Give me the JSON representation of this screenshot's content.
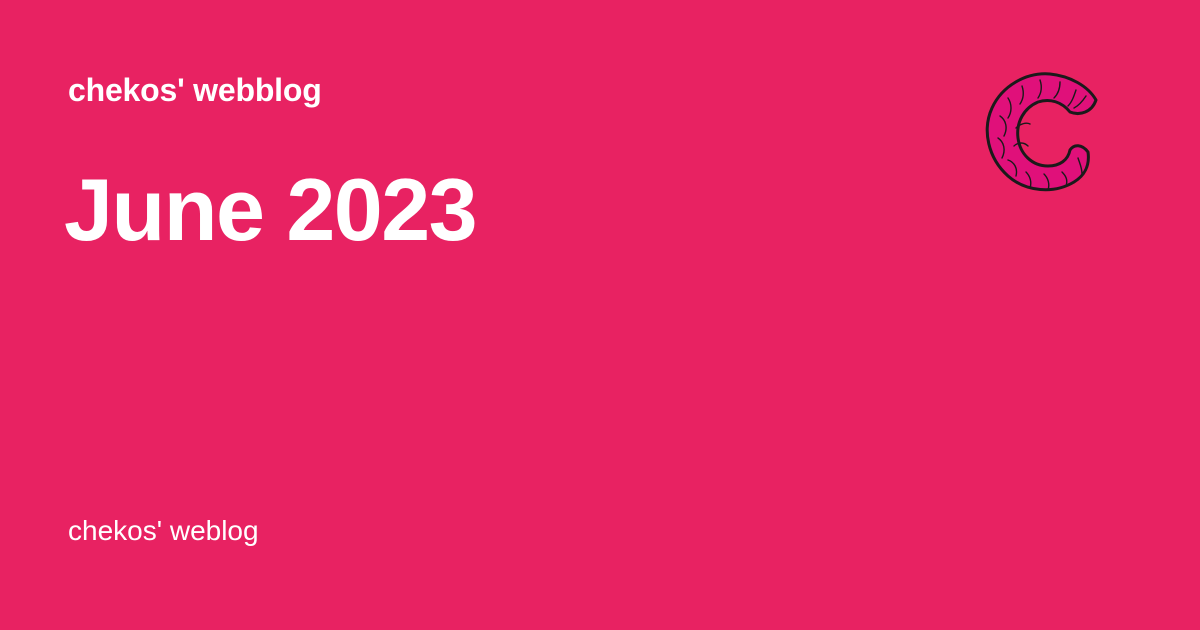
{
  "header": {
    "site_name": "chekos' webblog"
  },
  "main": {
    "title": "June 2023"
  },
  "footer": {
    "site_name": "chekos' weblog"
  },
  "logo": {
    "icon": "croissant-c-logo-icon",
    "fill_color": "#e0107a",
    "stroke_color": "#1a1a1a"
  },
  "colors": {
    "background": "#e82262",
    "text": "#ffffff"
  }
}
